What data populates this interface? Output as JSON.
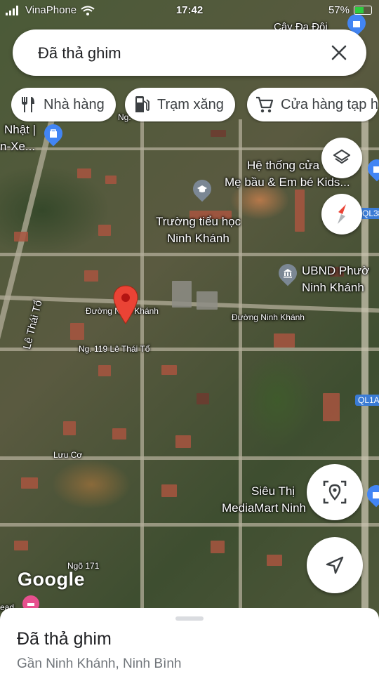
{
  "status_bar": {
    "carrier": "VinaPhone",
    "time": "17:42",
    "battery": "57%"
  },
  "search": {
    "query": "Đã thả ghim"
  },
  "chips": [
    {
      "label": "Nhà hàng",
      "icon": "restaurant-icon"
    },
    {
      "label": "Trạm xăng",
      "icon": "gas-station-icon"
    },
    {
      "label": "Cửa hàng tạp h",
      "icon": "shopping-cart-icon"
    }
  ],
  "map": {
    "labels": {
      "cay_da_doi": "Cây Đa Đôi",
      "nhat_1": "Nhật |",
      "nhat_2": "n-Xe...",
      "ng": "Ng.",
      "he_thong_1": "Hệ thống cửa",
      "he_thong_2": "Mẹ bầu & Em bé Kids...",
      "truong_1": "Trường tiểu học",
      "truong_2": "Ninh Khánh",
      "ubnd_1": "UBND Phườ",
      "ubnd_2": "Ninh Khánh",
      "le_thai_to": "Lê Thái Tổ",
      "duong_ninh_khanh_1": "Đường Ninh Khánh",
      "duong_ninh_khanh_2": "Đường Ninh Khánh",
      "ng119": "Ng. 119 Lê Thái Tổ",
      "luu_co": "Lưu Cơ",
      "sieu_thi_1": "Siêu Thị",
      "sieu_thi_2": "MediaMart Ninh",
      "ngo171": "Ngõ 171",
      "ql1a": "QL1A",
      "ql38": "QL38",
      "road_end": "ead"
    },
    "attribution": "Google"
  },
  "colors": {
    "pin": "#ea4335",
    "poi_blue": "#4285f4",
    "poi_gray": "#7b8794",
    "compass_red": "#ea4335"
  },
  "sheet": {
    "title": "Đã thả ghim",
    "subtitle": "Gần Ninh Khánh, Ninh Bình"
  }
}
